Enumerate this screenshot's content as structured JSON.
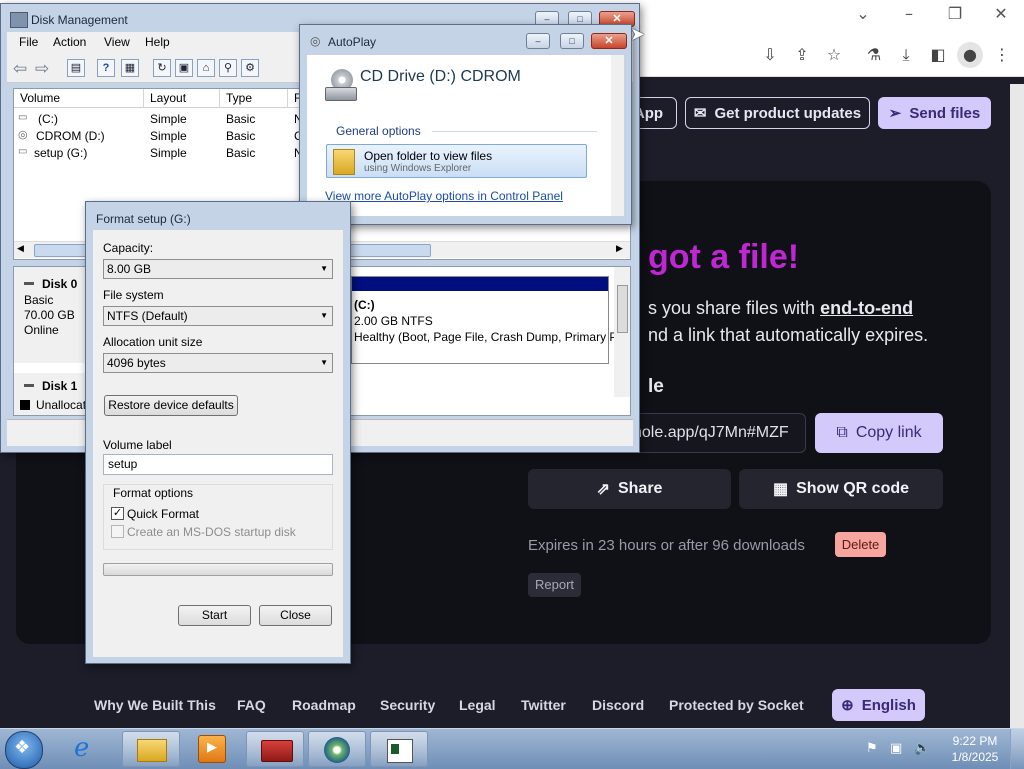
{
  "browser": {
    "nav_buttons": {
      "app_label": "App",
      "updates_label": "Get product updates",
      "send_label": "Send files"
    },
    "hero": {
      "title": "got a file!",
      "line1_prefix": "s you share files with ",
      "line1_bold": "end-to-end",
      "line2": "nd a link that automatically expires.",
      "section_heading": "le"
    },
    "link": {
      "url_text": "hole.app/qJ7Mn#MZF",
      "copy_label": "Copy link"
    },
    "actions": {
      "share_label": "Share",
      "qr_label": "Show QR code"
    },
    "expiry": {
      "text": "Expires in 23 hours or after 96 downloads",
      "delete_label": "Delete",
      "report_label": "Report"
    },
    "footer": {
      "links": [
        "Why We Built This",
        "FAQ",
        "Roadmap",
        "Security",
        "Legal",
        "Twitter",
        "Discord",
        "Protected by Socket"
      ],
      "language_label": "English"
    }
  },
  "disk_management": {
    "title": "Disk Management",
    "menu": [
      "File",
      "Action",
      "View",
      "Help"
    ],
    "columns": [
      "Volume",
      "Layout",
      "Type",
      "F"
    ],
    "volumes": [
      {
        "name": "(C:)",
        "layout": "Simple",
        "type": "Basic",
        "extra": "N"
      },
      {
        "name": "CDROM (D:)",
        "layout": "Simple",
        "type": "Basic",
        "extra": "C"
      },
      {
        "name": "setup (G:)",
        "layout": "Simple",
        "type": "Basic",
        "extra": "N"
      }
    ],
    "disk0": {
      "name": "Disk 0",
      "kind": "Basic",
      "size": "70.00 GB",
      "status": "Online"
    },
    "disk0_partition": {
      "label": "(C:)",
      "size": "2.00 GB NTFS",
      "status": "Healthy (Boot, Page File, Crash Dump, Primary P"
    },
    "disk1": {
      "name": "Disk 1",
      "legend": "Unallocat"
    }
  },
  "autoplay": {
    "title": "AutoPlay",
    "drive": "CD Drive (D:) CDROM",
    "section": "General options",
    "option_title": "Open folder to view files",
    "option_sub": "using Windows Explorer",
    "more_link": "View more AutoPlay options in Control Panel"
  },
  "format": {
    "title": "Format setup (G:)",
    "capacity_label": "Capacity:",
    "capacity_value": "8.00 GB",
    "fs_label": "File system",
    "fs_value": "NTFS (Default)",
    "alloc_label": "Allocation unit size",
    "alloc_value": "4096 bytes",
    "restore_label": "Restore device defaults",
    "volume_label": "Volume label",
    "volume_value": "setup",
    "options_label": "Format options",
    "quick_format": "Quick Format",
    "quick_format_checked": true,
    "msdos": "Create an MS-DOS startup disk",
    "start_label": "Start",
    "close_label": "Close"
  },
  "taskbar": {
    "time": "9:22 PM",
    "date": "1/8/2025"
  },
  "colors": {
    "accent_lavender": "#d4c9fb",
    "hero_purple": "#c026d3",
    "delete_red": "#f8a5a0"
  }
}
